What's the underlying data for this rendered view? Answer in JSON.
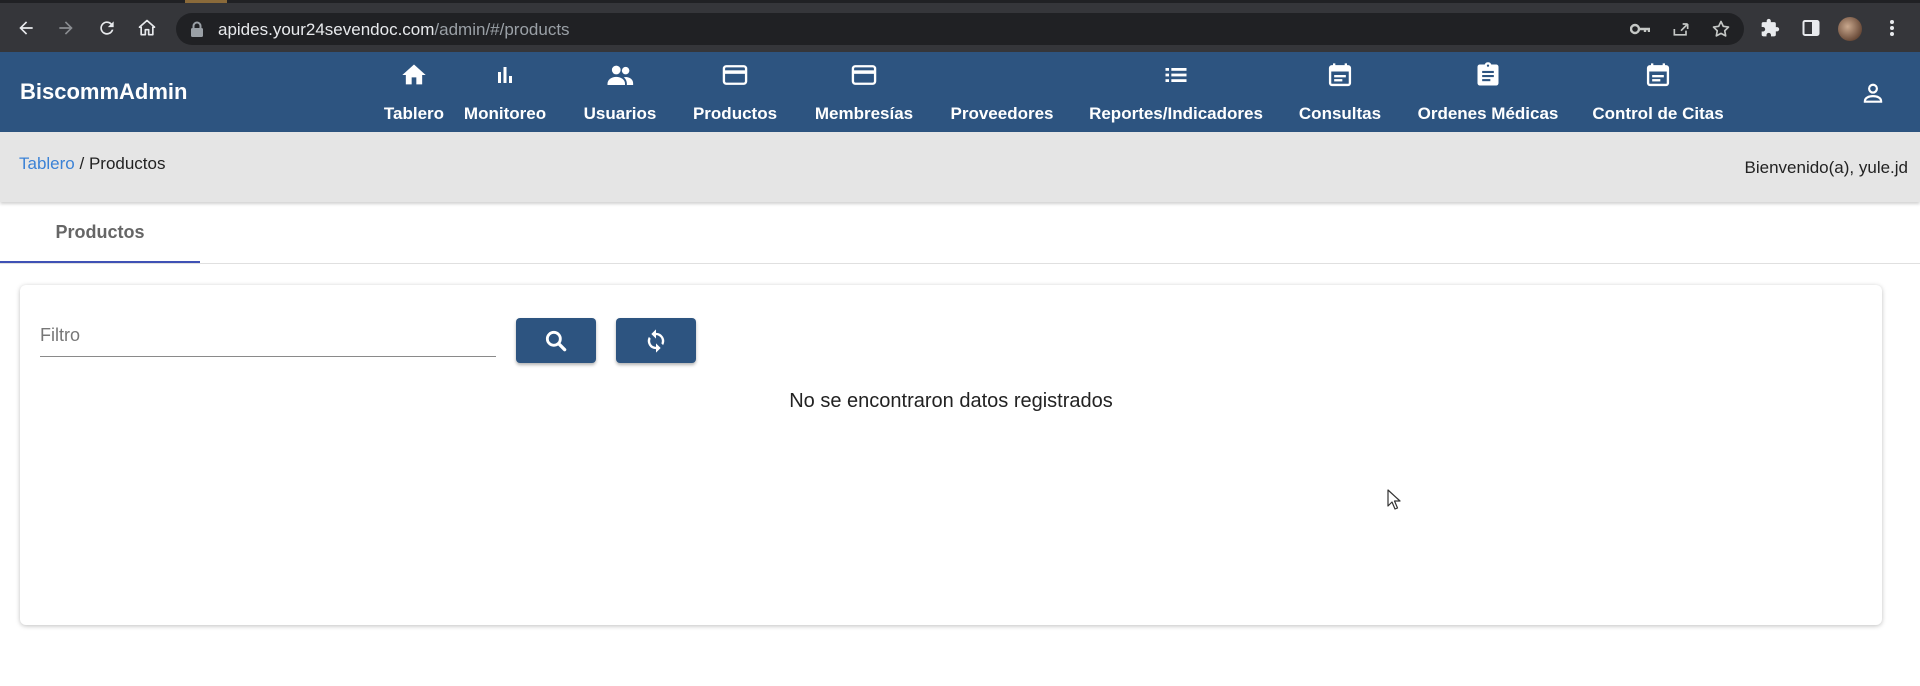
{
  "browser": {
    "url_host": "apides.your24sevendoc.com",
    "url_path": "/admin/#/products"
  },
  "app": {
    "brand": "BiscommAdmin"
  },
  "nav": {
    "items": [
      {
        "label": "Tablero",
        "icon": "home-icon"
      },
      {
        "label": "Monitoreo",
        "icon": "bar-chart-icon"
      },
      {
        "label": "Usuarios",
        "icon": "people-icon"
      },
      {
        "label": "Productos",
        "icon": "card-icon"
      },
      {
        "label": "Membresías",
        "icon": "card-icon"
      },
      {
        "label": "Proveedores",
        "icon": ""
      },
      {
        "label": "Reportes/Indicadores",
        "icon": "list-icon"
      },
      {
        "label": "Consultas",
        "icon": "calendar-icon"
      },
      {
        "label": "Ordenes Médicas",
        "icon": "clipboard-icon"
      },
      {
        "label": "Control de Citas",
        "icon": "calendar-icon"
      }
    ]
  },
  "breadcrumb": {
    "home": "Tablero",
    "separator": " / ",
    "current": "Productos"
  },
  "welcome": "Bienvenido(a), yule.jd",
  "tabs": {
    "active": "Productos"
  },
  "filter": {
    "placeholder": "Filtro",
    "value": ""
  },
  "empty_message": "No se encontraron datos registrados",
  "colors": {
    "primary": "#2d5480",
    "tab_indicator": "#3f51b5",
    "link": "#3b82d6"
  }
}
